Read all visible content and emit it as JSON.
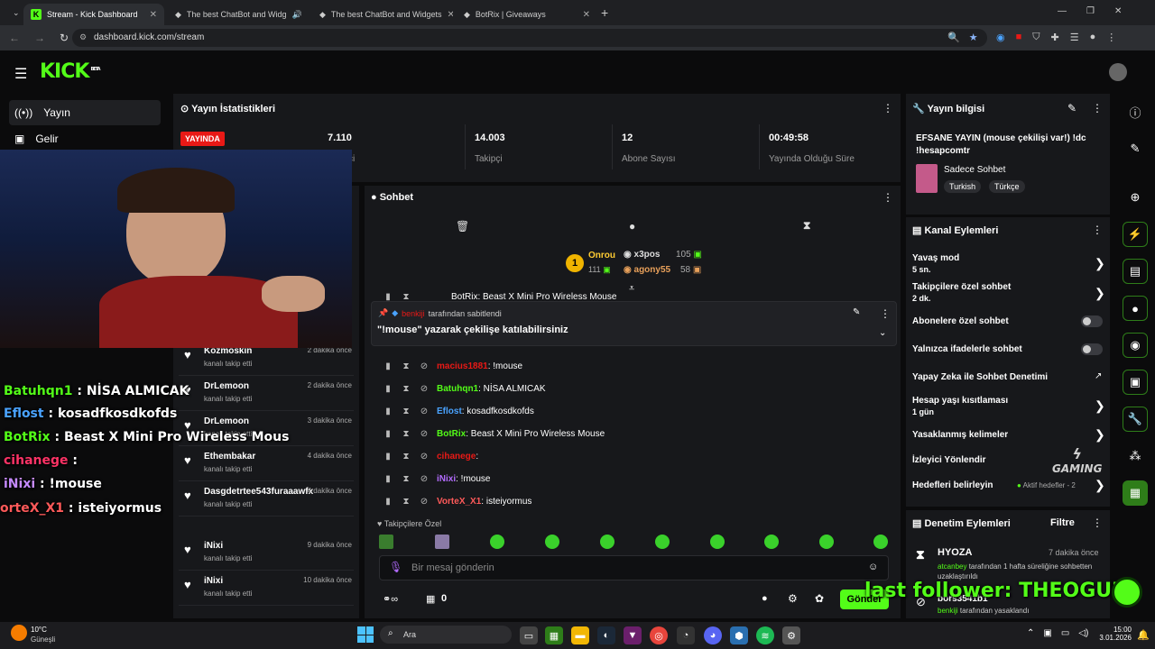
{
  "browser": {
    "tabs": [
      {
        "title": "Stream - Kick Dashboard"
      },
      {
        "title": "The best ChatBot and Widg"
      },
      {
        "title": "The best ChatBot and Widgets"
      },
      {
        "title": "BotRix | Giveaways"
      }
    ],
    "url": "dashboard.kick.com/stream"
  },
  "app": {
    "logo": "KICK",
    "beta": "BETA"
  },
  "sidebar": {
    "items": [
      {
        "label": "Yayın"
      },
      {
        "label": "Gelir"
      }
    ]
  },
  "stats": {
    "title": "Yayın İstatistikleri",
    "live_badge": "YAYINDA",
    "items": [
      {
        "value": "7.110",
        "label": "ci"
      },
      {
        "value": "14.003",
        "label": "Takipçi"
      },
      {
        "value": "12",
        "label": "Abone Sayısı"
      },
      {
        "value": "00:49:58",
        "label": "Yayında Olduğu Süre"
      }
    ]
  },
  "chat": {
    "title": "Sohbet",
    "leaderboard": {
      "first": {
        "rank": "1",
        "name": "Onrou",
        "count": "111"
      },
      "second": {
        "name": "x3pos",
        "count": "105"
      },
      "third": {
        "name": "agony55",
        "count": "58"
      }
    },
    "partial_line": "BotRix: Beast X Mini Pro Wireless Mouse",
    "pinned": {
      "by": "benkiji",
      "by_suffix": "tarafından sabitlendi",
      "text": "\"!mouse\" yazarak çekilişe katılabilirsiniz"
    },
    "messages": [
      {
        "user": "macius1881",
        "text": ": !mouse",
        "color": "#e91916"
      },
      {
        "user": "Batuhqn1",
        "text": ": NİSA ALMICAK",
        "color": "#53fc18"
      },
      {
        "user": "Eflost",
        "text": ": kosadfkosdkofds",
        "color": "#4aa3ff"
      },
      {
        "user": "BotRix",
        "text": ": Beast X Mini Pro Wireless Mouse",
        "color": "#53fc18"
      },
      {
        "user": "cihanege",
        "text": ":",
        "color": "#e91916"
      },
      {
        "user": "iNixi",
        "text": ": !mouse",
        "color": "#b36bff"
      },
      {
        "user": "VorteX_X1",
        "text": ": isteiyormus",
        "color": "#ff5a5a"
      }
    ],
    "followers_only": "Takipçilere Özel",
    "input_placeholder": "Bir mesaj gönderin",
    "points": "0",
    "send_label": "Gönder"
  },
  "followers": [
    {
      "name": "Kozmoskin",
      "sub": "kanalı takip etti",
      "time": "2 dakika önce"
    },
    {
      "name": "DrLemoon",
      "sub": "kanalı takip etti",
      "time": "2 dakika önce"
    },
    {
      "name": "DrLemoon",
      "sub": "kanalı takip etti",
      "time": "3 dakika önce"
    },
    {
      "name": "Ethembakar",
      "sub": "kanalı takip etti",
      "time": "4 dakika önce"
    },
    {
      "name": "Dasgdetrtee543furaaawfx",
      "sub": "kanalı takip etti",
      "time": "4 dakika önce"
    },
    {
      "name": "iNixi",
      "sub": "kanalı takip etti",
      "time": "9 dakika önce"
    },
    {
      "name": "iNixi",
      "sub": "kanalı takip etti",
      "time": "10 dakika önce"
    }
  ],
  "stream_info": {
    "title": "Yayın bilgisi",
    "stream_title": "EFSANE YAYIN (mouse çekilişi var!) !dc !hesapcomtr",
    "category": "Sadece Sohbet",
    "tags": [
      "Turkish",
      "Türkçe"
    ]
  },
  "channel_actions": {
    "title": "Kanal Eylemleri",
    "rows": [
      {
        "label": "Yavaş mod",
        "sub": "5 sn."
      },
      {
        "label": "Takipçilere özel sohbet",
        "sub": "2 dk."
      },
      {
        "label": "Abonelere özel sohbet"
      },
      {
        "label": "Yalnızca ifadelerle sohbet"
      },
      {
        "label": "Yapay Zeka ile Sohbet Denetimi"
      },
      {
        "label": "Hesap yaşı kısıtlaması",
        "sub": "1 gün"
      },
      {
        "label": "Yasaklanmış kelimeler"
      },
      {
        "label": "İzleyici Yönlendir"
      },
      {
        "label": "Hedefleri belirleyin",
        "status": "Aktif hedefler - 2"
      }
    ]
  },
  "moderation": {
    "title": "Denetim Eylemleri",
    "filter_label": "Filtre",
    "entries": [
      {
        "user": "HYOZA",
        "time": "7 dakika önce",
        "by": "atcanbey",
        "text": "tarafından 1 hafta süreliğine sohbetten uzaklaştırıldı"
      },
      {
        "user": "bors3541b1",
        "by": "benkiji",
        "text": "tarafından yasaklandı"
      }
    ]
  },
  "overlay": {
    "chat": [
      {
        "user": "Batuhqn1",
        "text": " : NİSA ALMICAK",
        "color": "#53fc18"
      },
      {
        "user": "Eflost",
        "text": " : kosadfkosdkofds",
        "color": "#4aa3ff"
      },
      {
        "user": "BotRix",
        "text": " : Beast X Mini Pro Wireless Mous",
        "color": "#53fc18"
      },
      {
        "user": "cihanege",
        "text": " :",
        "color": "#ff3366"
      },
      {
        "user": "iNixi",
        "text": " : !mouse",
        "color": "#c58aff"
      },
      {
        "user": "orteX_X1",
        "text": " : isteiyormus",
        "color": "#ff5a5a"
      }
    ],
    "last_follower": "last follower: THEOGUN",
    "gaming_logo": "GAMING"
  },
  "taskbar": {
    "weather_temp": "10°C",
    "weather_desc": "Güneşli",
    "search": "Ara",
    "time": "15:00",
    "date": "3.01.2026"
  }
}
